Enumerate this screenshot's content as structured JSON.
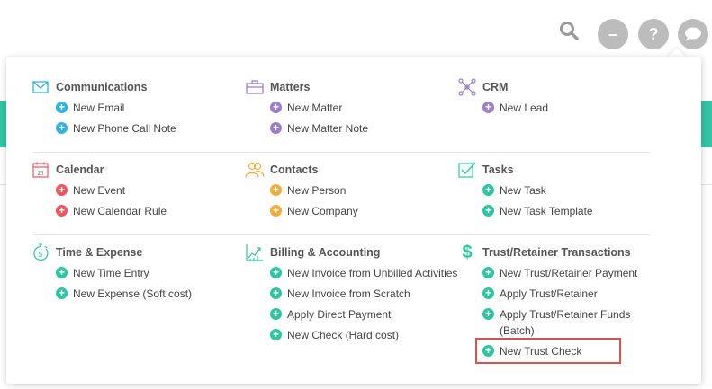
{
  "topbar": {
    "search_icon": "search-icon",
    "minus_label": "–",
    "help_label": "?",
    "chat_icon": "chat-bubble-icon"
  },
  "colors": {
    "blue": "#2fb3e0",
    "purple": "#9b7fc8",
    "red": "#e9575f",
    "orange": "#f2ac3b",
    "teal": "#2ec69f",
    "grey": "#bcbcbc"
  },
  "sections": {
    "communications": {
      "title": "Communications",
      "icon": "envelope-icon",
      "items": [
        "New Email",
        "New Phone Call Note"
      ]
    },
    "matters": {
      "title": "Matters",
      "icon": "briefcase-icon",
      "items": [
        "New Matter",
        "New Matter Note"
      ]
    },
    "crm": {
      "title": "CRM",
      "icon": "network-icon",
      "items": [
        "New Lead"
      ]
    },
    "calendar": {
      "title": "Calendar",
      "icon": "calendar-icon",
      "icon_text": "25",
      "items": [
        "New Event",
        "New Calendar Rule"
      ]
    },
    "contacts": {
      "title": "Contacts",
      "icon": "contacts-icon",
      "items": [
        "New Person",
        "New Company"
      ]
    },
    "tasks": {
      "title": "Tasks",
      "icon": "checkbox-icon",
      "items": [
        "New Task",
        "New Task Template"
      ]
    },
    "time_expense": {
      "title": "Time & Expense",
      "icon": "stopwatch-dollar-icon",
      "items": [
        "New Time Entry",
        "New Expense (Soft cost)"
      ]
    },
    "billing": {
      "title": "Billing & Accounting",
      "icon": "chart-icon",
      "items": [
        "New Invoice from Unbilled Activities",
        "New Invoice from Scratch",
        "Apply Direct Payment",
        "New Check (Hard cost)"
      ]
    },
    "trust": {
      "title": "Trust/Retainer Transactions",
      "icon": "dollar-icon",
      "icon_text": "$",
      "items": [
        "New Trust/Retainer Payment",
        "Apply Trust/Retainer",
        "Apply Trust/Retainer Funds",
        "(Batch)",
        "New Trust Check"
      ]
    }
  }
}
